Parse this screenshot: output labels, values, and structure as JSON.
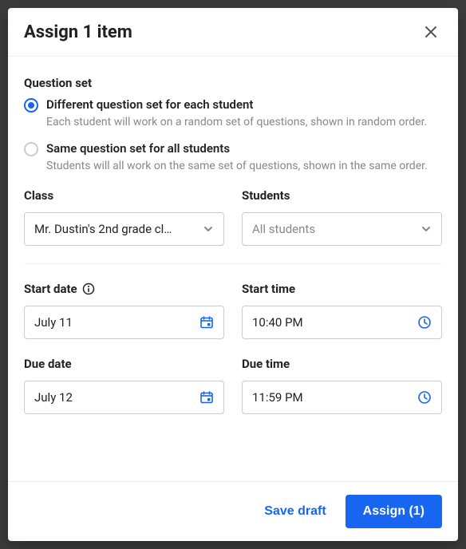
{
  "header": {
    "title": "Assign 1 item"
  },
  "question_set": {
    "label": "Question set",
    "options": [
      {
        "title": "Different question set for each student",
        "desc": "Each student will work on a random set of questions, shown in random order.",
        "selected": true
      },
      {
        "title": "Same question set for all students",
        "desc": "Students will all work on the same set of questions, shown in the same order.",
        "selected": false
      }
    ]
  },
  "class_field": {
    "label": "Class",
    "value": "Mr. Dustin's 2nd grade cl…"
  },
  "students_field": {
    "label": "Students",
    "value": "All students"
  },
  "start_date": {
    "label": "Start date",
    "value": "July 11"
  },
  "start_time": {
    "label": "Start time",
    "value": "10:40 PM"
  },
  "due_date": {
    "label": "Due date",
    "value": "July 12"
  },
  "due_time": {
    "label": "Due time",
    "value": "11:59 PM"
  },
  "footer": {
    "save_draft": "Save draft",
    "assign": "Assign (1)"
  },
  "colors": {
    "accent": "#1865f2"
  }
}
